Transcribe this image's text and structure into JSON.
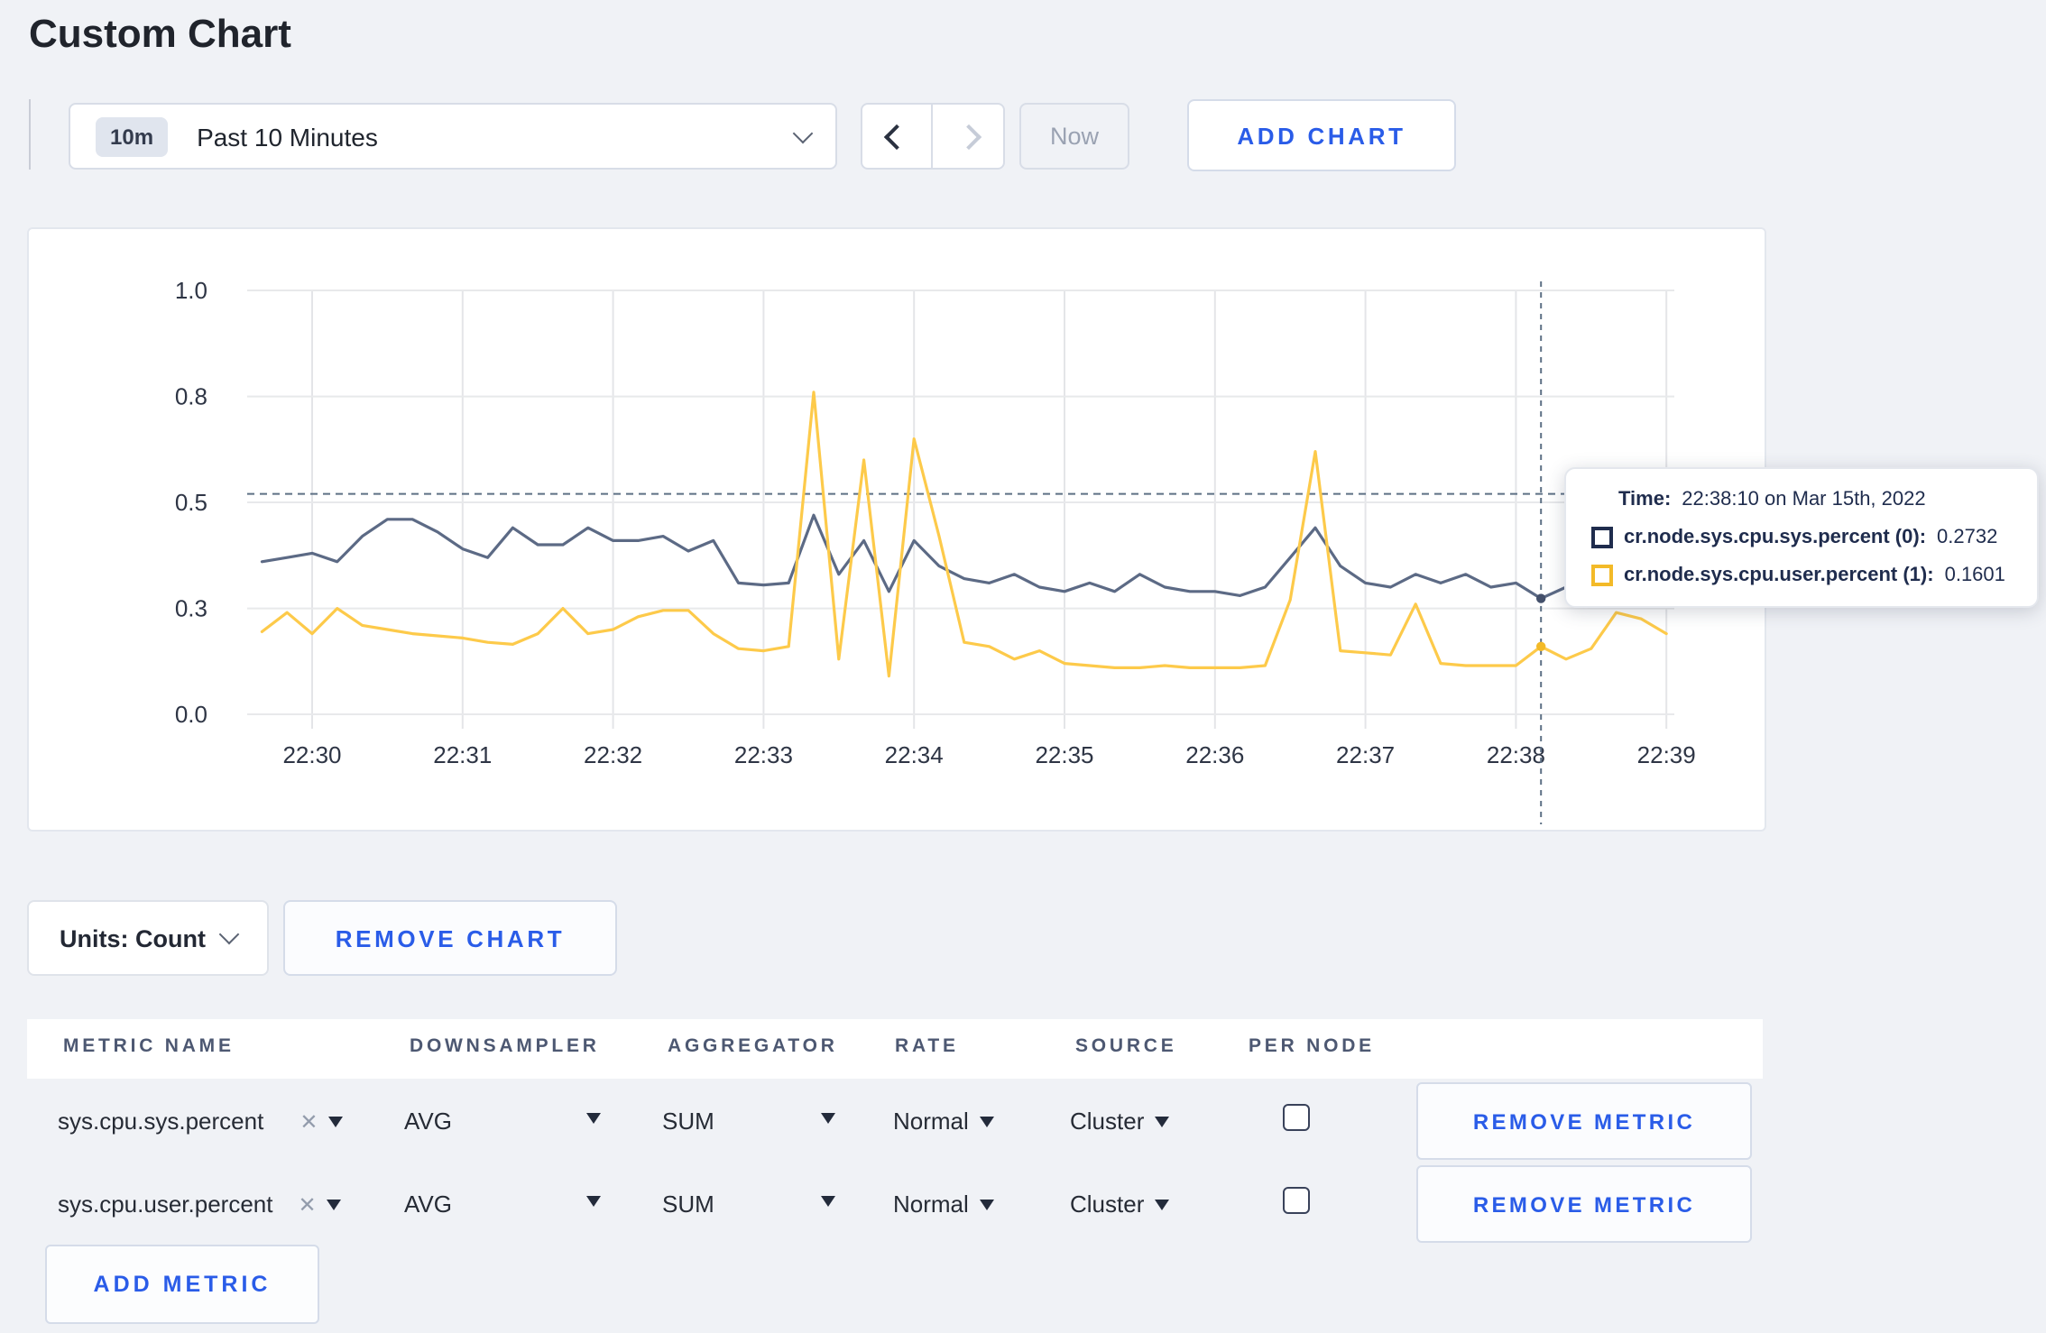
{
  "page": {
    "title": "Custom Chart",
    "background": "#f0f2f6",
    "accent_blue": "#2a5ce8"
  },
  "toolbar": {
    "time_window_badge": "10m",
    "time_window_label": "Past 10 Minutes",
    "now_label": "Now",
    "add_chart_label": "ADD CHART"
  },
  "chart": {
    "tooltip": {
      "time_label": "Time:",
      "time_value": "22:38:10 on Mar 15th, 2022",
      "series": [
        {
          "label": "cr.node.sys.cpu.sys.percent (0):",
          "value": "0.2732",
          "swatch_color": "#1f2c4d"
        },
        {
          "label": "cr.node.sys.cpu.user.percent (1):",
          "value": "0.1601",
          "swatch_color": "#f3ba28"
        }
      ]
    }
  },
  "chart_data": {
    "type": "line",
    "title": "",
    "xlabel": "",
    "ylabel": "",
    "grid": true,
    "ylim": [
      0,
      1
    ],
    "x_tick_labels": [
      "22:30",
      "22:31",
      "22:32",
      "22:33",
      "22:34",
      "22:35",
      "22:36",
      "22:37",
      "22:38",
      "22:39"
    ],
    "y_ticks": [
      {
        "value": 0,
        "label": "0.0"
      },
      {
        "value": 0.25,
        "label": "0.3"
      },
      {
        "value": 0.5,
        "label": "0.5"
      },
      {
        "value": 0.75,
        "label": "0.8"
      },
      {
        "value": 1,
        "label": "1.0"
      }
    ],
    "x_start_time": "22:29:40",
    "x_start_offset_seconds": 20,
    "x_step_seconds": 10,
    "series": [
      {
        "name": "cr.node.sys.cpu.sys.percent",
        "color": "#5c6a85",
        "dot_color": "#44506b",
        "values": [
          0.36,
          0.37,
          0.38,
          0.36,
          0.42,
          0.46,
          0.46,
          0.43,
          0.39,
          0.37,
          0.44,
          0.4,
          0.4,
          0.44,
          0.41,
          0.41,
          0.42,
          0.385,
          0.41,
          0.31,
          0.305,
          0.31,
          0.47,
          0.33,
          0.41,
          0.29,
          0.41,
          0.35,
          0.32,
          0.31,
          0.33,
          0.3,
          0.29,
          0.31,
          0.29,
          0.33,
          0.3,
          0.29,
          0.29,
          0.28,
          0.3,
          0.37,
          0.44,
          0.35,
          0.31,
          0.3,
          0.33,
          0.31,
          0.33,
          0.3,
          0.31,
          0.2732,
          0.3,
          0.29,
          0.3,
          0.31,
          0.3
        ]
      },
      {
        "name": "cr.node.sys.cpu.user.percent",
        "color": "#fdca4a",
        "dot_color": "#f3ba28",
        "values": [
          0.195,
          0.24,
          0.19,
          0.25,
          0.21,
          0.2,
          0.19,
          0.185,
          0.18,
          0.17,
          0.165,
          0.19,
          0.25,
          0.19,
          0.2,
          0.23,
          0.245,
          0.245,
          0.19,
          0.155,
          0.15,
          0.16,
          0.76,
          0.13,
          0.6,
          0.09,
          0.65,
          0.42,
          0.17,
          0.16,
          0.13,
          0.15,
          0.12,
          0.115,
          0.11,
          0.11,
          0.115,
          0.11,
          0.11,
          0.11,
          0.115,
          0.27,
          0.62,
          0.15,
          0.145,
          0.14,
          0.26,
          0.12,
          0.115,
          0.115,
          0.115,
          0.1601,
          0.13,
          0.155,
          0.24,
          0.225,
          0.19
        ]
      }
    ],
    "crosshair": {
      "time": "22:38:10",
      "index": 51,
      "hline_value": 0.52
    },
    "legend_position": "tooltip"
  },
  "units_bar": {
    "units_label": "Units: Count",
    "remove_chart_label": "REMOVE CHART"
  },
  "metrics_table": {
    "headers": [
      "METRIC NAME",
      "DOWNSAMPLER",
      "AGGREGATOR",
      "RATE",
      "SOURCE",
      "PER NODE"
    ],
    "rows": [
      {
        "metric_name": "sys.cpu.sys.percent",
        "downsampler": "AVG",
        "aggregator": "SUM",
        "rate": "Normal",
        "source": "Cluster",
        "per_node_checked": false,
        "remove_label": "REMOVE METRIC"
      },
      {
        "metric_name": "sys.cpu.user.percent",
        "downsampler": "AVG",
        "aggregator": "SUM",
        "rate": "Normal",
        "source": "Cluster",
        "per_node_checked": false,
        "remove_label": "REMOVE METRIC"
      }
    ],
    "add_metric_label": "ADD METRIC"
  }
}
